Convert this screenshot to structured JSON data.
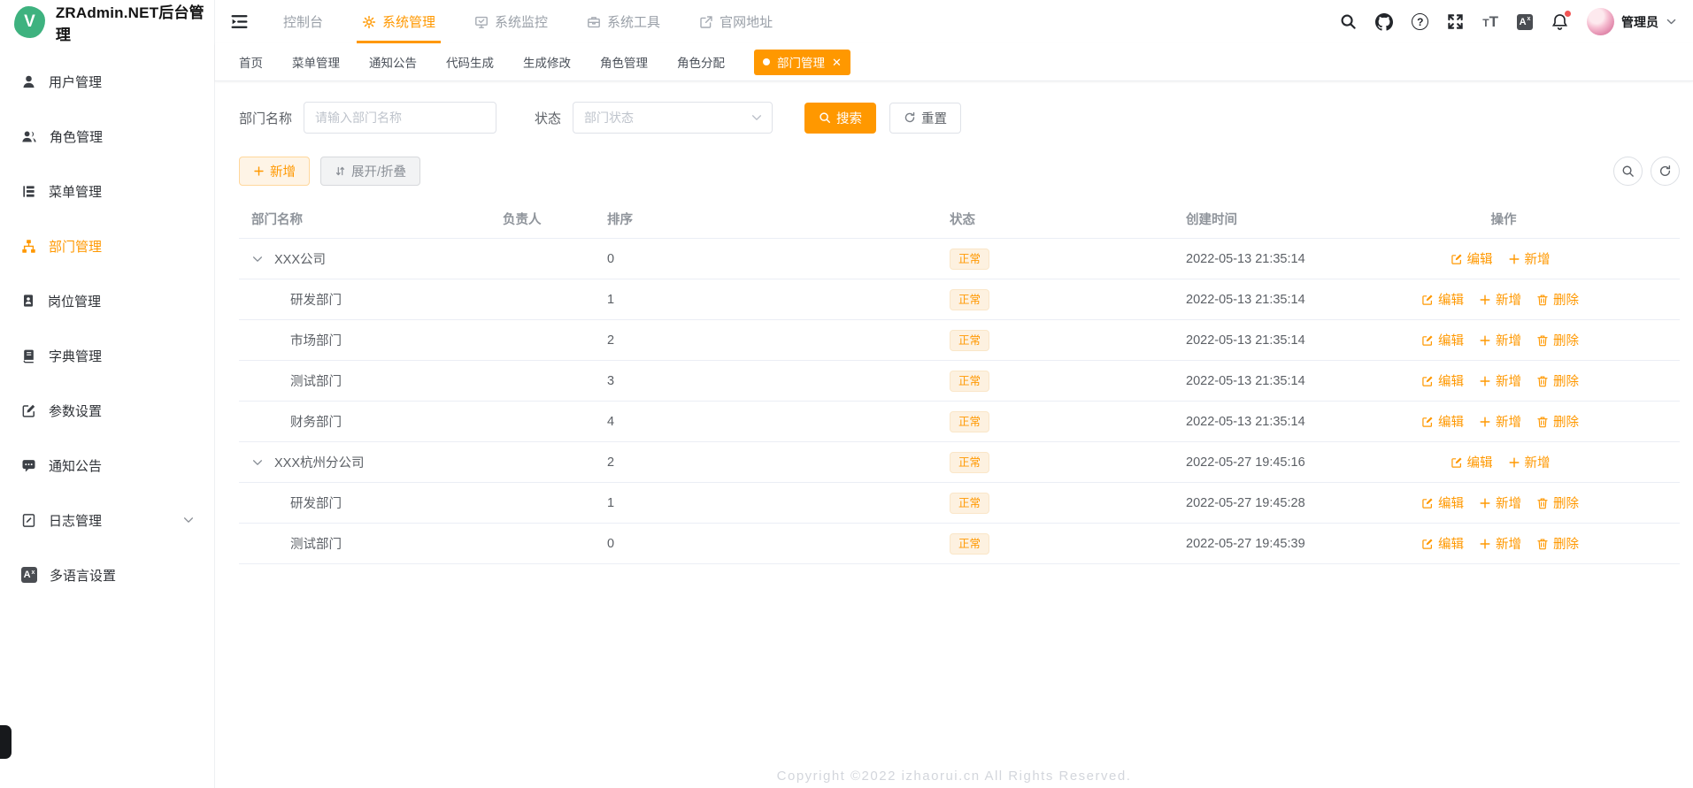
{
  "app": {
    "title": "ZRAdmin.NET后台管理"
  },
  "colors": {
    "accent": "#ff9800",
    "logo_green": "#3eb27f",
    "badge_bg": "#fdf1e0",
    "notice_red": "#f25656"
  },
  "header": {
    "nav": [
      {
        "label": "控制台",
        "icon": "",
        "key": "console",
        "active": false
      },
      {
        "label": "系统管理",
        "icon": "gear",
        "key": "system",
        "active": true
      },
      {
        "label": "系统监控",
        "icon": "monitor",
        "key": "monitor",
        "active": false
      },
      {
        "label": "系统工具",
        "icon": "toolbox",
        "key": "tools",
        "active": false
      },
      {
        "label": "官网地址",
        "icon": "external-link",
        "key": "website",
        "active": false
      }
    ],
    "user": {
      "name": "管理员"
    }
  },
  "sidebar": {
    "items": [
      {
        "label": "用户管理",
        "icon": "user",
        "active": false
      },
      {
        "label": "角色管理",
        "icon": "users",
        "active": false
      },
      {
        "label": "菜单管理",
        "icon": "menu-tree",
        "active": false
      },
      {
        "label": "部门管理",
        "icon": "org-tree",
        "active": true
      },
      {
        "label": "岗位管理",
        "icon": "id-badge",
        "active": false
      },
      {
        "label": "字典管理",
        "icon": "book",
        "active": false
      },
      {
        "label": "参数设置",
        "icon": "edit-square",
        "active": false
      },
      {
        "label": "通知公告",
        "icon": "message",
        "active": false
      },
      {
        "label": "日志管理",
        "icon": "log",
        "active": false,
        "expandable": true
      },
      {
        "label": "多语言设置",
        "icon": "translate",
        "active": false
      }
    ]
  },
  "tags": {
    "items": [
      {
        "label": "首页",
        "key": "home",
        "active": false
      },
      {
        "label": "菜单管理",
        "key": "menu",
        "active": false
      },
      {
        "label": "通知公告",
        "key": "notice",
        "active": false
      },
      {
        "label": "代码生成",
        "key": "codegen",
        "active": false
      },
      {
        "label": "生成修改",
        "key": "gen-edit",
        "active": false
      },
      {
        "label": "角色管理",
        "key": "role",
        "active": false
      },
      {
        "label": "角色分配",
        "key": "role-assign",
        "active": false
      },
      {
        "label": "部门管理",
        "key": "dept",
        "active": true,
        "closable": true
      }
    ]
  },
  "search": {
    "dept_label": "部门名称",
    "dept_placeholder": "请输入部门名称",
    "status_label": "状态",
    "status_placeholder": "部门状态",
    "search_button": "搜索",
    "reset_button": "重置"
  },
  "toolbar": {
    "add_button": "新增",
    "fold_button": "展开/折叠"
  },
  "table": {
    "columns": [
      "部门名称",
      "负责人",
      "排序",
      "状态",
      "创建时间",
      "操作"
    ],
    "rows": [
      {
        "name": "XXX公司",
        "parent": true,
        "leader": "",
        "sort": "0",
        "status": "正常",
        "created": "2022-05-13 21:35:14",
        "actions": [
          {
            "label": "编辑",
            "icon": "edit"
          },
          {
            "label": "新增",
            "icon": "plus"
          }
        ]
      },
      {
        "name": "研发部门",
        "parent": false,
        "leader": "",
        "sort": "1",
        "status": "正常",
        "created": "2022-05-13 21:35:14",
        "actions": [
          {
            "label": "编辑",
            "icon": "edit"
          },
          {
            "label": "新增",
            "icon": "plus"
          },
          {
            "label": "删除",
            "icon": "trash"
          }
        ]
      },
      {
        "name": "市场部门",
        "parent": false,
        "leader": "",
        "sort": "2",
        "status": "正常",
        "created": "2022-05-13 21:35:14",
        "actions": [
          {
            "label": "编辑",
            "icon": "edit"
          },
          {
            "label": "新增",
            "icon": "plus"
          },
          {
            "label": "删除",
            "icon": "trash"
          }
        ]
      },
      {
        "name": "测试部门",
        "parent": false,
        "leader": "",
        "sort": "3",
        "status": "正常",
        "created": "2022-05-13 21:35:14",
        "actions": [
          {
            "label": "编辑",
            "icon": "edit"
          },
          {
            "label": "新增",
            "icon": "plus"
          },
          {
            "label": "删除",
            "icon": "trash"
          }
        ]
      },
      {
        "name": "财务部门",
        "parent": false,
        "leader": "",
        "sort": "4",
        "status": "正常",
        "created": "2022-05-13 21:35:14",
        "actions": [
          {
            "label": "编辑",
            "icon": "edit"
          },
          {
            "label": "新增",
            "icon": "plus"
          },
          {
            "label": "删除",
            "icon": "trash"
          }
        ]
      },
      {
        "name": "XXX杭州分公司",
        "parent": true,
        "leader": "",
        "sort": "2",
        "status": "正常",
        "created": "2022-05-27 19:45:16",
        "actions": [
          {
            "label": "编辑",
            "icon": "edit"
          },
          {
            "label": "新增",
            "icon": "plus"
          }
        ]
      },
      {
        "name": "研发部门",
        "parent": false,
        "leader": "",
        "sort": "1",
        "status": "正常",
        "created": "2022-05-27 19:45:28",
        "actions": [
          {
            "label": "编辑",
            "icon": "edit"
          },
          {
            "label": "新增",
            "icon": "plus"
          },
          {
            "label": "删除",
            "icon": "trash"
          }
        ]
      },
      {
        "name": "测试部门",
        "parent": false,
        "leader": "",
        "sort": "0",
        "status": "正常",
        "created": "2022-05-27 19:45:39",
        "actions": [
          {
            "label": "编辑",
            "icon": "edit"
          },
          {
            "label": "新增",
            "icon": "plus"
          },
          {
            "label": "删除",
            "icon": "trash"
          }
        ]
      }
    ]
  },
  "footer": {
    "copyright": "Copyright ©2022 izhaorui.cn All Rights Reserved."
  }
}
